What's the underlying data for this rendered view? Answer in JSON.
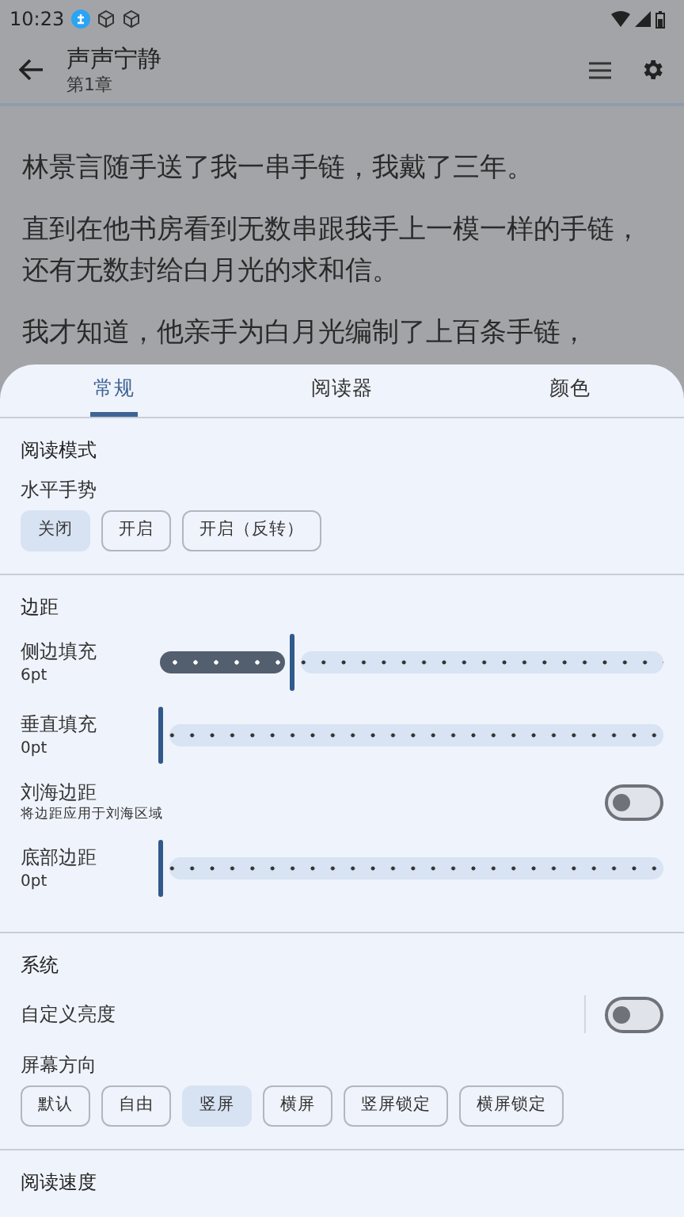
{
  "status_bar": {
    "time": "10:23"
  },
  "app_bar": {
    "title": "声声宁静",
    "subtitle": "第1章"
  },
  "reader": {
    "paragraphs": [
      "林景言随手送了我一串手链，我戴了三年。",
      "直到在他书房看到无数串跟我手上一模一样的手链，还有无数封给白月光的求和信。",
      "我才知道，他亲手为白月光编制了上百条手链，"
    ]
  },
  "settings_sheet": {
    "tabs": [
      {
        "label": "常规",
        "selected": true
      },
      {
        "label": "阅读器",
        "selected": false
      },
      {
        "label": "颜色",
        "selected": false
      }
    ],
    "sections": [
      {
        "title": "阅读模式",
        "items": [
          {
            "kind": "chips",
            "label": "水平手势",
            "options": [
              {
                "label": "关闭",
                "selected": true
              },
              {
                "label": "开启",
                "selected": false
              },
              {
                "label": "开启（反转）",
                "selected": false
              }
            ]
          }
        ]
      },
      {
        "title": "边距",
        "items": [
          {
            "kind": "slider",
            "label": "侧边填充",
            "reading": "6pt",
            "level": 0.26
          },
          {
            "kind": "slider",
            "label": "垂直填充",
            "reading": "0pt",
            "level": 0
          },
          {
            "kind": "switch",
            "label": "刘海边距",
            "description": "将边距应用于刘海区域",
            "on": false
          },
          {
            "kind": "slider",
            "label": "底部边距",
            "reading": "0pt",
            "level": 0
          }
        ]
      },
      {
        "title": "系统",
        "items": [
          {
            "kind": "switch",
            "label": "自定义亮度",
            "on": false,
            "divider": true
          },
          {
            "kind": "chips",
            "label": "屏幕方向",
            "options": [
              {
                "label": "默认",
                "selected": false
              },
              {
                "label": "自由",
                "selected": false
              },
              {
                "label": "竖屏",
                "selected": true
              },
              {
                "label": "横屏",
                "selected": false
              },
              {
                "label": "竖屏锁定",
                "selected": false
              },
              {
                "label": "横屏锁定",
                "selected": false
              }
            ]
          }
        ]
      },
      {
        "title": "阅读速度"
      }
    ]
  }
}
